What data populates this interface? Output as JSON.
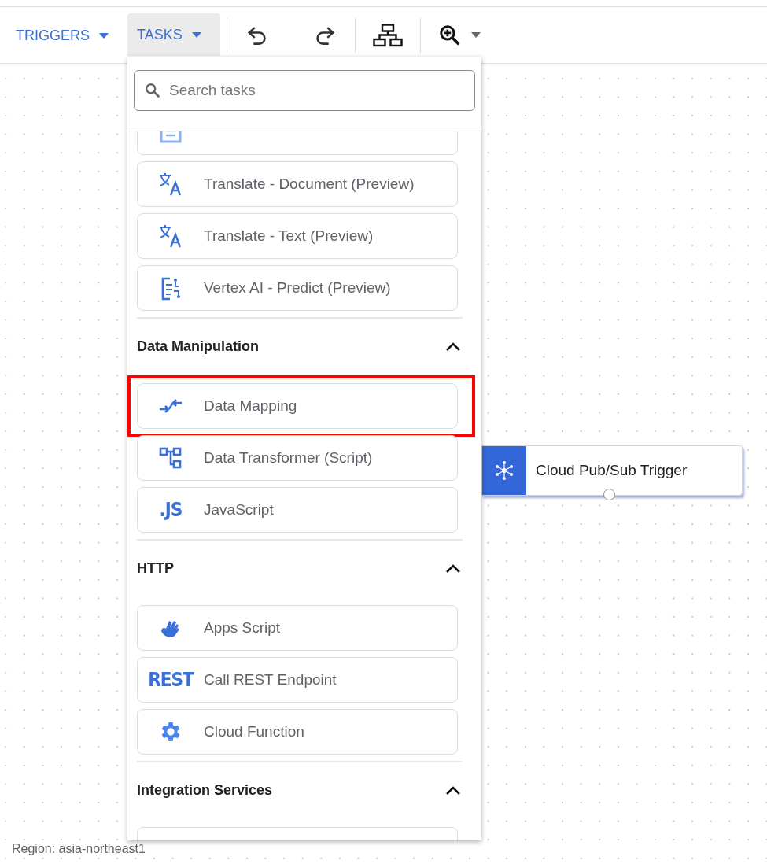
{
  "toolbar": {
    "menus": [
      {
        "label": "TRIGGERS",
        "selected": false
      },
      {
        "label": "TASKS",
        "selected": true
      }
    ]
  },
  "task_panel": {
    "search": {
      "placeholder": "Search tasks"
    },
    "sections": [
      {
        "items": [
          {
            "kind": "doc"
          },
          {
            "kind": "translate",
            "label": "Translate - Document (Preview)",
            "highlighted": false
          },
          {
            "kind": "translate",
            "label": "Translate - Text (Preview)",
            "highlighted": false
          },
          {
            "kind": "vertex",
            "label": "Vertex AI - Predict (Preview)",
            "highlighted": false
          }
        ]
      },
      {
        "title": "Data Manipulation",
        "expanded": true,
        "items": [
          {
            "kind": "mapping",
            "label": "Data Mapping",
            "highlighted": true
          },
          {
            "kind": "transformer",
            "label": "Data Transformer (Script)",
            "highlighted": false
          },
          {
            "kind": "text",
            "icon_text": ".JS",
            "label": "JavaScript",
            "highlighted": false
          }
        ]
      },
      {
        "title": "HTTP",
        "expanded": true,
        "items": [
          {
            "kind": "apps-script",
            "label": "Apps Script",
            "highlighted": false
          },
          {
            "kind": "text",
            "icon_text": "REST",
            "label": "Call REST Endpoint",
            "highlighted": false
          },
          {
            "kind": "gear",
            "label": "Cloud Function",
            "highlighted": false
          }
        ]
      },
      {
        "title": "Integration Services",
        "expanded": true,
        "items": [
          {
            "kind": "hidden"
          }
        ]
      }
    ]
  },
  "canvas": {
    "node": {
      "title": "Cloud Pub/Sub Trigger"
    },
    "region": "Region: asia-northeast1"
  }
}
